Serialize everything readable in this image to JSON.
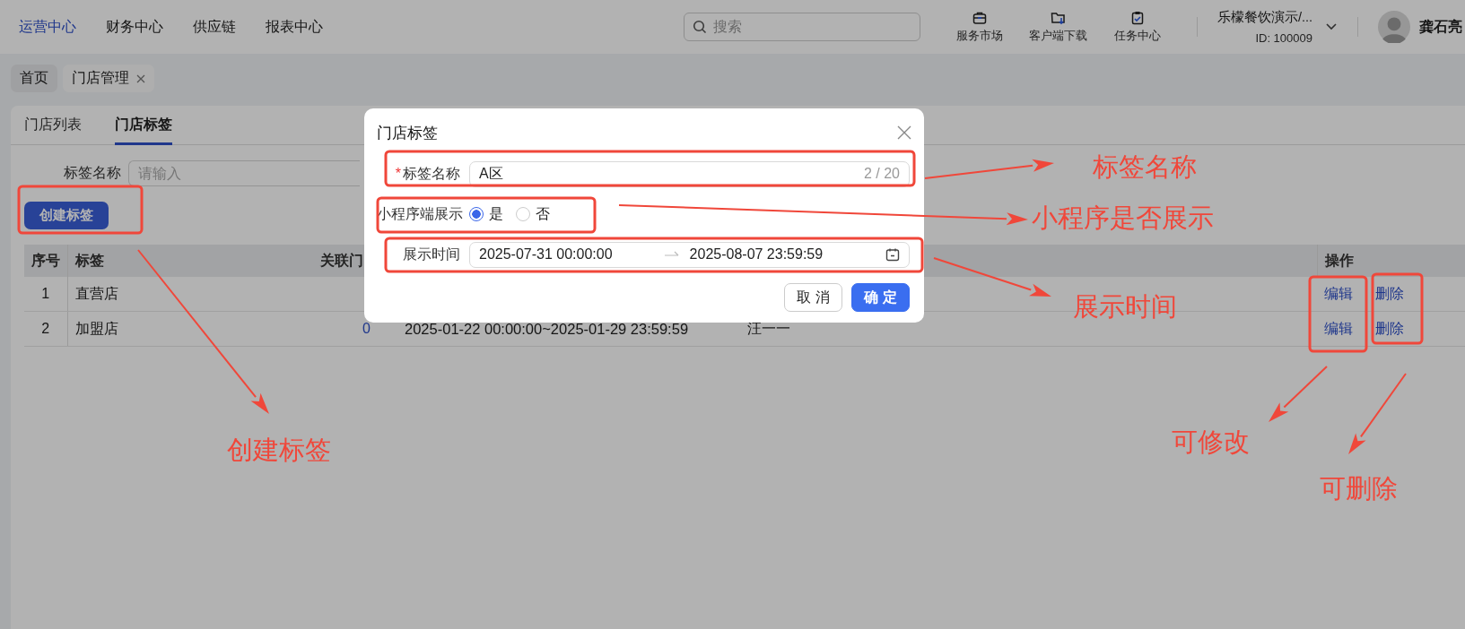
{
  "top_nav": {
    "menu": [
      {
        "label": "运营中心",
        "selected": true
      },
      {
        "label": "财务中心",
        "selected": false
      },
      {
        "label": "供应链",
        "selected": false
      },
      {
        "label": "报表中心",
        "selected": false
      }
    ],
    "search": {
      "placeholder": "搜索"
    },
    "tools": [
      {
        "kind": "briefcase",
        "label": "服务市场"
      },
      {
        "kind": "download",
        "label": "客户端下载"
      },
      {
        "kind": "tasks",
        "label": "任务中心"
      }
    ],
    "account": {
      "name": "乐檬餐饮演示/...",
      "id": "ID: 100009"
    },
    "user": {
      "name": "龚石亮"
    }
  },
  "page_tabs": [
    {
      "label": "首页",
      "selected": false,
      "closable": false
    },
    {
      "label": "门店管理",
      "selected": true,
      "closable": true
    }
  ],
  "content_tabs": [
    {
      "label": "门店列表",
      "selected": false
    },
    {
      "label": "门店标签",
      "selected": true
    }
  ],
  "filter": {
    "label": "标签名称",
    "placeholder": "请输入"
  },
  "create_button": "创建标签",
  "table": {
    "columns": [
      "序号",
      "标签",
      "关联门",
      "操作"
    ],
    "rows": [
      {
        "index": "1",
        "tag": "直营店",
        "actions": [
          "编辑",
          "删除"
        ]
      },
      {
        "index": "2",
        "tag": "加盟店",
        "store_count": "0",
        "period": "2025-01-22 00:00:00~2025-01-29 23:59:59",
        "column_5": "汪一一",
        "actions": [
          "编辑",
          "删除"
        ]
      }
    ]
  },
  "dialog": {
    "title": "门店标签",
    "fields": [
      {
        "kind": "text",
        "label": "标签名称",
        "required_mark": "*",
        "value": "A区",
        "counter": "2 / 20"
      },
      {
        "kind": "radio",
        "label": "小程序端展示",
        "options": [
          {
            "label": "是",
            "selected": true
          },
          {
            "label": "否",
            "selected": false
          }
        ]
      },
      {
        "kind": "daterange",
        "label": "展示时间",
        "start": "2025-07-31 00:00:00",
        "end": "2025-08-07 23:59:59"
      }
    ],
    "buttons": [
      {
        "label": "取 消",
        "primary": false
      },
      {
        "label": "确 定",
        "primary": true
      }
    ]
  },
  "annotations": [
    {
      "text": "标签名称"
    },
    {
      "text": "小程序是否展示"
    },
    {
      "text": "展示时间"
    },
    {
      "text": "创建标签"
    },
    {
      "text": "可修改"
    },
    {
      "text": "可删除"
    }
  ]
}
